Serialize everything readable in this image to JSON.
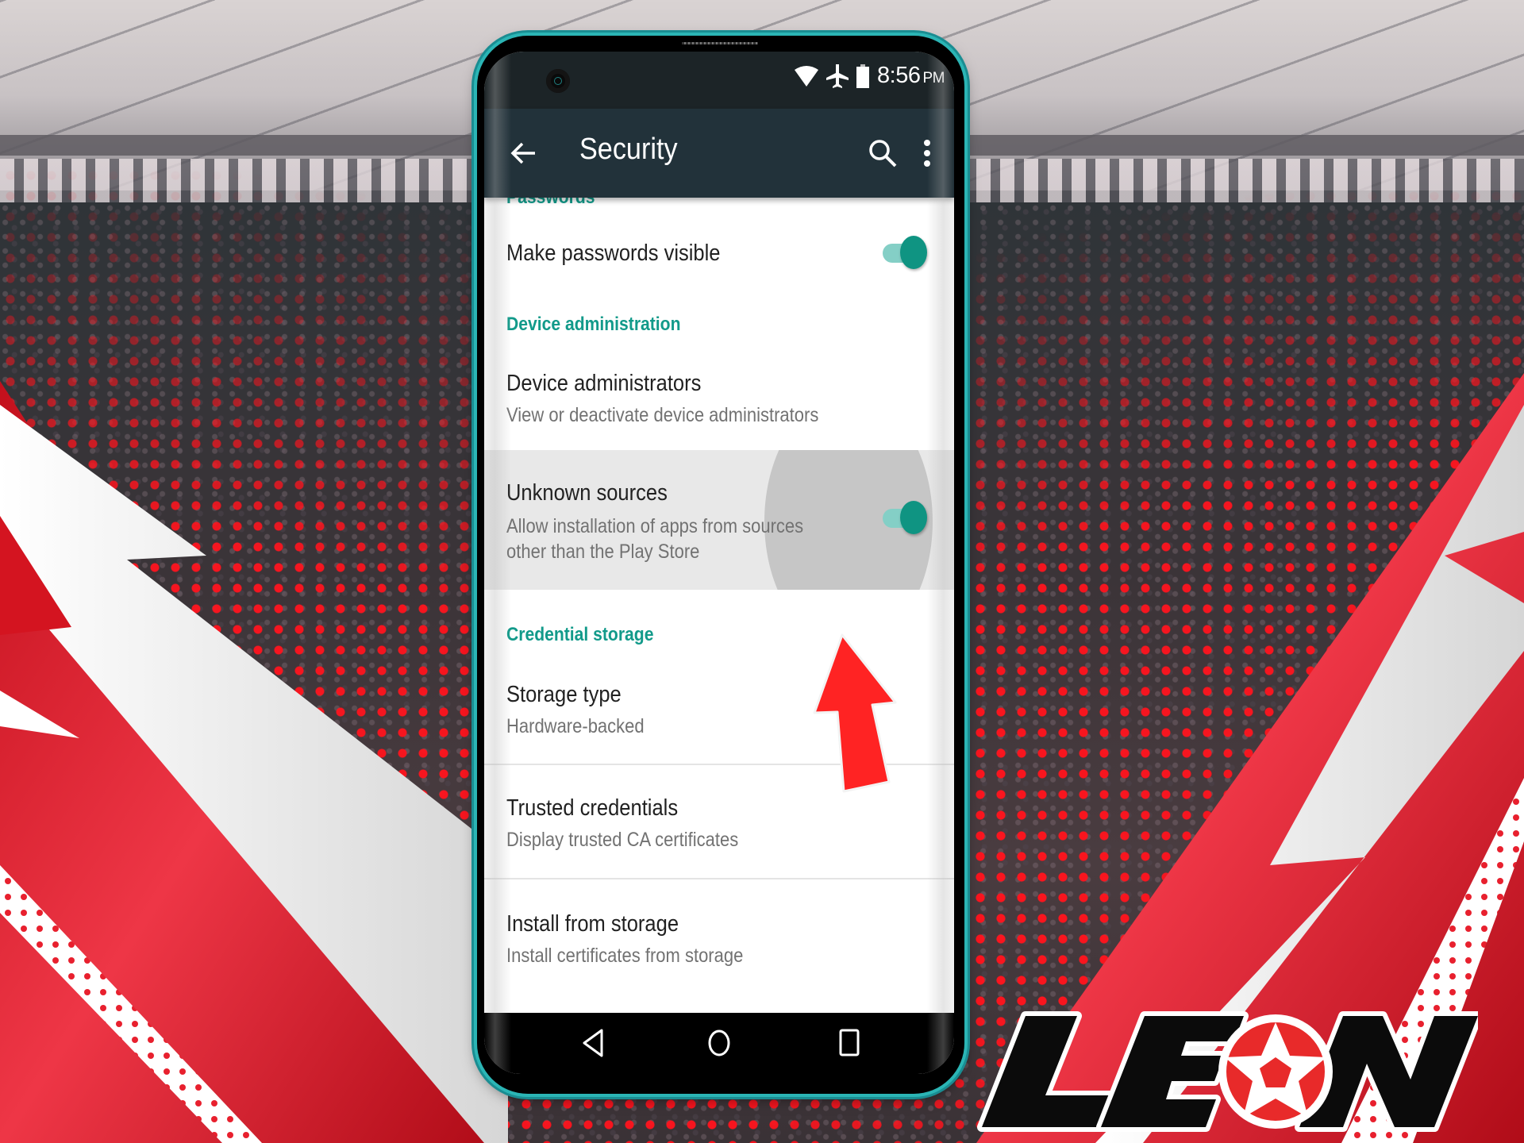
{
  "status_bar": {
    "time": "8:56",
    "ampm": "PM",
    "icons": [
      "wifi-icon",
      "airplane-icon",
      "battery-icon"
    ]
  },
  "toolbar": {
    "title": "Security",
    "back_icon": "arrow-left",
    "search_icon": "search",
    "more_icon": "more-vert"
  },
  "sections": {
    "passwords": {
      "header": "Passwords",
      "items": [
        {
          "title": "Make passwords visible",
          "toggle_on": true
        }
      ]
    },
    "device_administration": {
      "header": "Device administration",
      "items": [
        {
          "title": "Device administrators",
          "subtitle": "View or deactivate device administrators"
        },
        {
          "title": "Unknown sources",
          "subtitle_line1": "Allow installation of apps from sources",
          "subtitle_line2": "other than the Play Store",
          "toggle_on": true,
          "pressed": true
        }
      ]
    },
    "credential_storage": {
      "header": "Credential storage",
      "items": [
        {
          "title": "Storage type",
          "subtitle": "Hardware-backed"
        },
        {
          "title": "Trusted credentials",
          "subtitle": "Display trusted CA certificates"
        },
        {
          "title": "Install from storage",
          "subtitle": "Install certificates from storage"
        }
      ]
    }
  },
  "nav_bar": {
    "buttons": [
      "back",
      "home",
      "recents"
    ]
  },
  "annotation": {
    "type": "arrow-up",
    "color": "#ff2222",
    "points_to": "Unknown sources toggle"
  },
  "brand": {
    "logo_text": "LEON",
    "accent": "#e3121c"
  },
  "colors": {
    "accent_teal": "#129a8a",
    "toolbar": "#22323a",
    "statusbar": "#1c2427",
    "phone_frame": "#2bb5b5"
  }
}
